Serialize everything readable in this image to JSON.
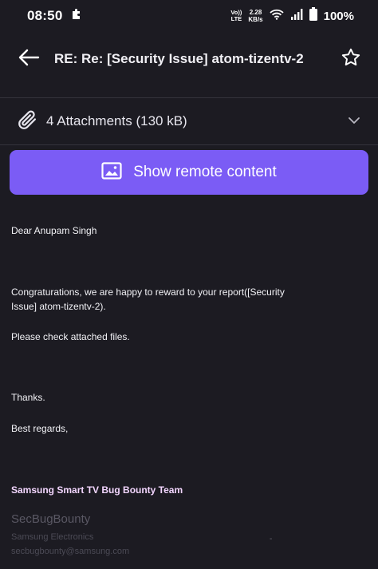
{
  "status_bar": {
    "time": "08:50",
    "volte": "Vo))",
    "lte": "LTE",
    "speed_value": "2.28",
    "speed_unit": "KB/s",
    "battery": "100%"
  },
  "header": {
    "subject": "RE: Re: [Security Issue] atom-tizentv-2",
    "icons": [
      "back-arrow-icon",
      "star-outline-icon"
    ]
  },
  "attachments": {
    "label": "4 Attachments (130 kB)",
    "icons": [
      "paperclip-icon",
      "chevron-down-icon"
    ]
  },
  "remote_content": {
    "label": "Show remote content",
    "icon": "image-icon"
  },
  "message": {
    "greeting": "Dear Anupam Singh",
    "paragraph1": "Congraturations, we are happy to reward to your report([Security Issue] atom-tizentv-2).",
    "paragraph2": "Please check attached files.",
    "thanks": "Thanks.",
    "regards": "Best regards,",
    "team": "Samsung Smart TV Bug Bounty Team",
    "logo_text": "SecBugBounty",
    "company": "Samsung Electronics",
    "email": "secbugbounty@samsung.com",
    "dash": "-"
  },
  "colors": {
    "background": "#1c1b22",
    "accent": "#7b5cf5",
    "team_text": "#f3d6ff"
  }
}
